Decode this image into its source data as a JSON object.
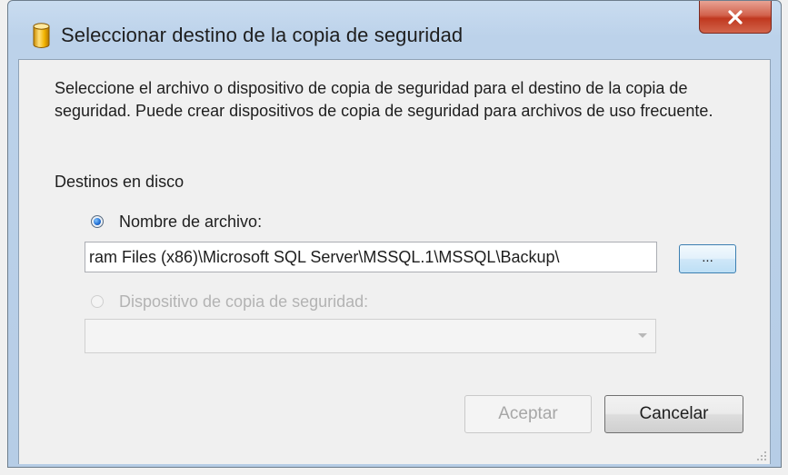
{
  "window": {
    "title": "Seleccionar destino de la copia de seguridad",
    "icon": "database-icon",
    "close_icon": "close-icon",
    "accent": "#c0381f"
  },
  "description": "Seleccione el archivo o dispositivo de copia de seguridad para el destino de la copia de seguridad. Puede crear dispositivos de copia de seguridad para archivos de uso frecuente.",
  "disk_targets": {
    "label": "Destinos en disco",
    "file_option": {
      "label": "Nombre de archivo:",
      "selected": true,
      "value": "ram Files (x86)\\Microsoft SQL Server\\MSSQL.1\\MSSQL\\Backup\\",
      "browse_label": "..."
    },
    "device_option": {
      "label": "Dispositivo de copia de seguridad:",
      "selected": false,
      "enabled": false,
      "value": ""
    }
  },
  "buttons": {
    "ok_label": "Aceptar",
    "ok_enabled": false,
    "cancel_label": "Cancelar"
  }
}
